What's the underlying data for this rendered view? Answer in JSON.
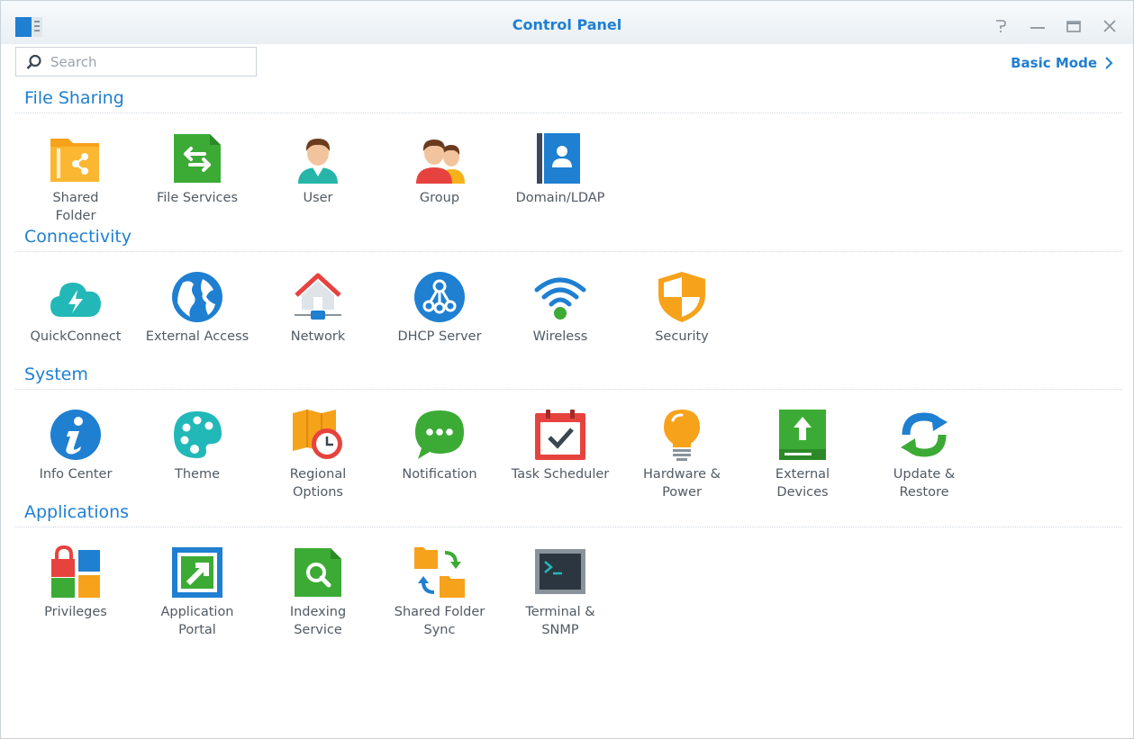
{
  "window": {
    "title": "Control Panel"
  },
  "search": {
    "placeholder": "Search",
    "value": ""
  },
  "basic_mode_label": "Basic Mode",
  "sections": [
    {
      "title": "File Sharing",
      "items": [
        {
          "label": "Shared\nFolder",
          "icon": "shared-folder-icon"
        },
        {
          "label": "File Services",
          "icon": "file-services-icon"
        },
        {
          "label": "User",
          "icon": "user-icon"
        },
        {
          "label": "Group",
          "icon": "group-icon"
        },
        {
          "label": "Domain/LDAP",
          "icon": "domain-ldap-icon"
        }
      ]
    },
    {
      "title": "Connectivity",
      "items": [
        {
          "label": "QuickConnect",
          "icon": "quickconnect-icon"
        },
        {
          "label": "External Access",
          "icon": "external-access-icon"
        },
        {
          "label": "Network",
          "icon": "network-icon"
        },
        {
          "label": "DHCP Server",
          "icon": "dhcp-server-icon"
        },
        {
          "label": "Wireless",
          "icon": "wireless-icon"
        },
        {
          "label": "Security",
          "icon": "security-icon"
        }
      ]
    },
    {
      "title": "System",
      "items": [
        {
          "label": "Info Center",
          "icon": "info-center-icon"
        },
        {
          "label": "Theme",
          "icon": "theme-icon"
        },
        {
          "label": "Regional\nOptions",
          "icon": "regional-options-icon"
        },
        {
          "label": "Notification",
          "icon": "notification-icon"
        },
        {
          "label": "Task Scheduler",
          "icon": "task-scheduler-icon"
        },
        {
          "label": "Hardware &\nPower",
          "icon": "hardware-power-icon"
        },
        {
          "label": "External\nDevices",
          "icon": "external-devices-icon"
        },
        {
          "label": "Update &\nRestore",
          "icon": "update-restore-icon"
        }
      ]
    },
    {
      "title": "Applications",
      "items": [
        {
          "label": "Privileges",
          "icon": "privileges-icon"
        },
        {
          "label": "Application\nPortal",
          "icon": "application-portal-icon"
        },
        {
          "label": "Indexing\nService",
          "icon": "indexing-service-icon"
        },
        {
          "label": "Shared Folder\nSync",
          "icon": "shared-folder-sync-icon"
        },
        {
          "label": "Terminal &\nSNMP",
          "icon": "terminal-snmp-icon"
        }
      ]
    }
  ],
  "colors": {
    "accent": "#1f7fd1",
    "text": "#505a64"
  }
}
